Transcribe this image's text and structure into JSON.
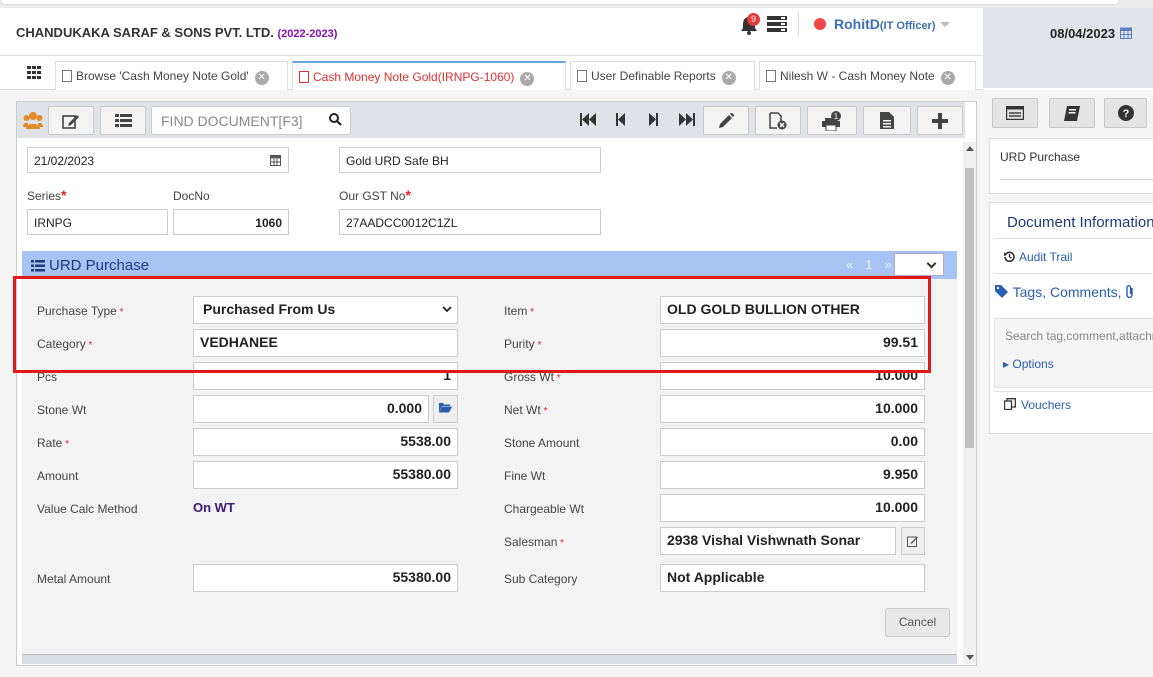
{
  "header": {
    "company": "CHANDUKAKA SARAF & SONS PVT. LTD.",
    "year": "(2022-2023)",
    "notification_count": "9",
    "user_name": "RohitD",
    "user_role": "(IT Officer)",
    "date": "08/04/2023"
  },
  "tabs": [
    {
      "label": "Browse 'Cash Money Note Gold'"
    },
    {
      "label": "Cash Money Note Gold(IRNPG-1060)"
    },
    {
      "label": "User Definable Reports"
    },
    {
      "label": "Nilesh W - Cash Money Note"
    }
  ],
  "toolbar": {
    "find_placeholder": "FIND DOCUMENT[F3]",
    "print_badge": "1"
  },
  "doc": {
    "date": "21/02/2023",
    "location": "Gold URD Safe BH",
    "series_label": "Series",
    "series": "IRNPG",
    "docno_label": "DocNo",
    "docno": "1060",
    "gst_label": "Our GST No",
    "gst": "27AADCC0012C1ZL"
  },
  "section": {
    "title": "URD Purchase",
    "pager_prev": "«",
    "pager_page": "1",
    "pager_next": "»"
  },
  "form": {
    "purchase_type_label": "Purchase Type",
    "purchase_type": "Purchased From Us",
    "item_label": "Item",
    "item": "OLD GOLD BULLION OTHER",
    "category_label": "Category",
    "category": "VEDHANEE",
    "purity_label": "Purity",
    "purity": "99.51",
    "pcs_label": "Pcs",
    "pcs": "1",
    "gross_wt_label": "Gross Wt",
    "gross_wt": "10.000",
    "stone_wt_label": "Stone Wt",
    "stone_wt": "0.000",
    "net_wt_label": "Net Wt",
    "net_wt": "10.000",
    "rate_label": "Rate",
    "rate": "5538.00",
    "stone_amount_label": "Stone Amount",
    "stone_amount": "0.00",
    "amount_label": "Amount",
    "amount": "55380.00",
    "fine_wt_label": "Fine Wt",
    "fine_wt": "9.950",
    "value_calc_label": "Value Calc Method",
    "value_calc": "On WT",
    "chargeable_wt_label": "Chargeable Wt",
    "chargeable_wt": "10.000",
    "salesman_label": "Salesman",
    "salesman": "2938 Vishal Vishwnath Sonar",
    "metal_amount_label": "Metal Amount",
    "metal_amount": "55380.00",
    "sub_category_label": "Sub Category",
    "sub_category": "Not Applicable",
    "cancel_label": "Cancel"
  },
  "right_panel": {
    "card_title": "URD Purchase",
    "doc_info_title": "Document Information",
    "audit_trail": "Audit Trail",
    "tags_comments": "Tags, Comments,",
    "search_placeholder": "Search tag,comment,attachm",
    "options": "Options",
    "vouchers": "Vouchers"
  },
  "colors": {
    "section_header": "#a6c3f3",
    "highlight_box": "#e01818",
    "active_tab": "#e03030",
    "link": "#2a5db0"
  }
}
